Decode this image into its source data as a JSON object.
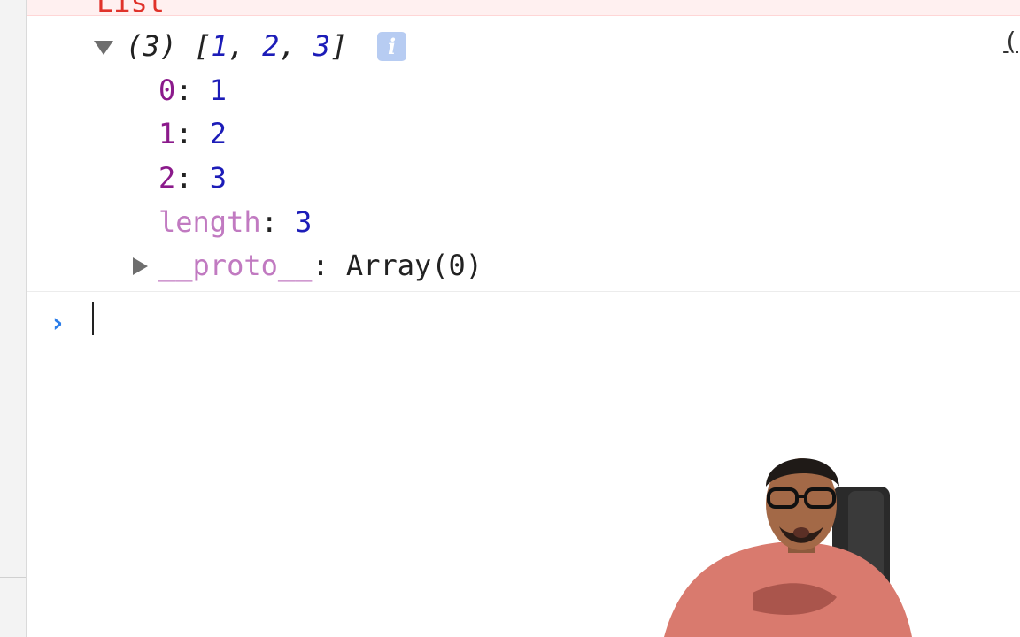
{
  "error_text": "List",
  "array": {
    "summary_prefix": "(3) [",
    "summary_items": [
      "1",
      "2",
      "3"
    ],
    "summary_suffix": "]",
    "info_badge": "i",
    "entries": [
      {
        "key": "0",
        "value": "1"
      },
      {
        "key": "1",
        "value": "2"
      },
      {
        "key": "2",
        "value": "3"
      }
    ],
    "length_key": "length",
    "length_value": "3",
    "proto_key": "__proto__",
    "proto_value": "Array(0)"
  },
  "source_link": "(",
  "prompt_symbol": "›",
  "colors": {
    "key": "#8b1a8b",
    "value": "#1c1cb8",
    "prompt": "#2b7de9",
    "error": "#e0322a"
  },
  "icons": [
    "expand-triangle-icon",
    "collapse-triangle-icon",
    "info-icon",
    "prompt-chevron-icon"
  ]
}
